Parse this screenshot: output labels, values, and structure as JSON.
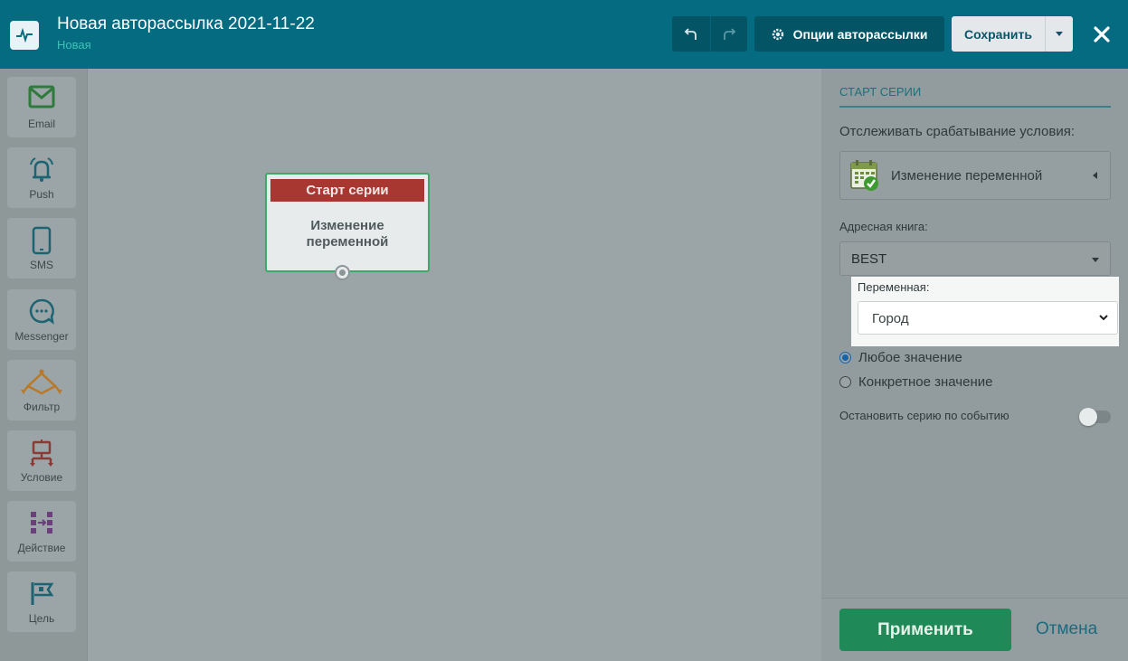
{
  "header": {
    "title": "Новая авторассылка 2021-11-22",
    "status": "Новая",
    "options_label": "Опции авторассылки",
    "save_label": "Сохранить",
    "icons": [
      "pulse-icon",
      "undo-icon",
      "redo-icon",
      "gear-icon",
      "chevron-down-icon",
      "close-icon"
    ]
  },
  "sidebar": {
    "items": [
      {
        "label": "Email",
        "icon": "email-icon",
        "color": "#2f7a3c"
      },
      {
        "label": "Push",
        "icon": "bell-icon",
        "color": "#1d6472"
      },
      {
        "label": "SMS",
        "icon": "phone-icon",
        "color": "#1d6472"
      },
      {
        "label": "Messenger",
        "icon": "chat-icon",
        "color": "#1d6472"
      },
      {
        "label": "Фильтр",
        "icon": "filter-icon",
        "color": "#b8792a"
      },
      {
        "label": "Условие",
        "icon": "condition-icon",
        "color": "#8b3a35"
      },
      {
        "label": "Действие",
        "icon": "action-icon",
        "color": "#6a3f7a"
      },
      {
        "label": "Цель",
        "icon": "flag-icon",
        "color": "#1d6472"
      }
    ]
  },
  "canvas": {
    "node": {
      "header": "Старт серии",
      "line1": "Изменение",
      "line2": "переменной"
    }
  },
  "panel": {
    "section_title": "СТАРТ СЕРИИ",
    "track_label": "Отслеживать срабатывание условия:",
    "condition_value": "Изменение переменной",
    "address_book_label": "Адресная книга:",
    "address_book_value": "BEST",
    "variable_label": "Переменная:",
    "variable_value": "Город",
    "radio_any": "Любое значение",
    "radio_specific": "Конкретное значение",
    "stop_label": "Остановить серию по событию"
  },
  "footer": {
    "apply_label": "Применить",
    "cancel_label": "Отмена"
  },
  "colors": {
    "header_bg": "#046b80",
    "accent_green": "#1f8a57",
    "node_header": "#a83731",
    "subtitle": "#3dc3b5"
  }
}
